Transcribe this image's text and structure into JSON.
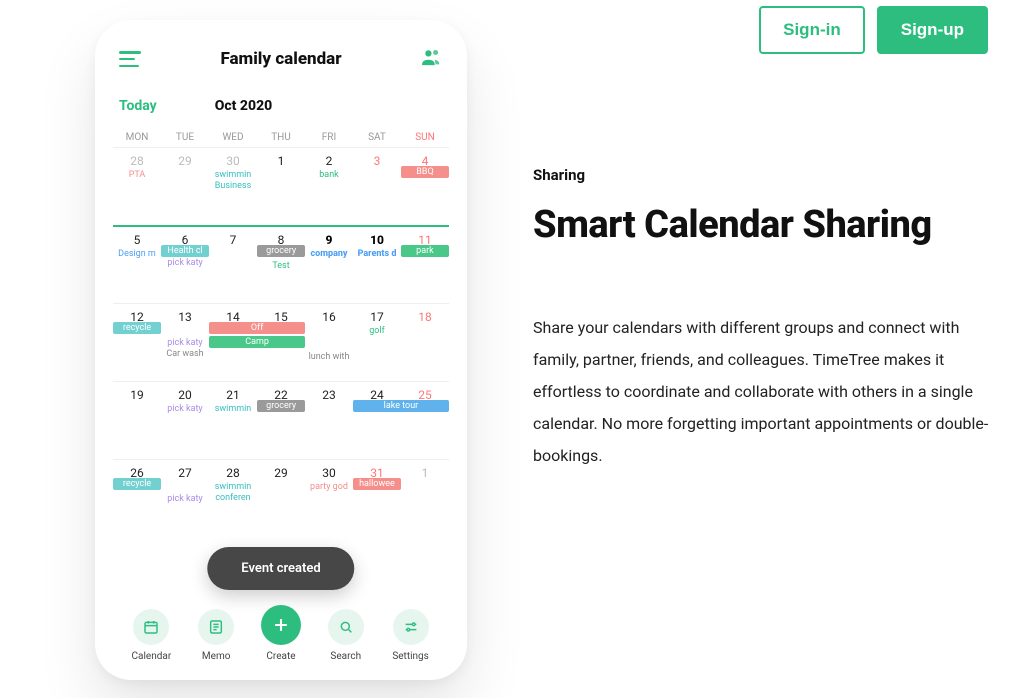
{
  "auth": {
    "signin": "Sign-in",
    "signup": "Sign-up"
  },
  "copy": {
    "eyebrow": "Sharing",
    "headline": "Smart Calendar Sharing",
    "body": "Share your calendars with different groups and connect with family, partner, friends, and colleagues. TimeTree makes it effortless to coordinate and collaborate with others in a single calendar. No more forgetting important appointments or double-bookings."
  },
  "phone": {
    "title": "Family calendar",
    "today": "Today",
    "month": "Oct 2020",
    "weekdays": {
      "mon": "MON",
      "tue": "TUE",
      "wed": "WED",
      "thu": "THU",
      "fri": "FRI",
      "sat": "SAT",
      "sun": "SUN"
    },
    "toast": "Event created",
    "nav": {
      "calendar": "Calendar",
      "memo": "Memo",
      "create": "Create",
      "search": "Search",
      "settings": "Settings"
    },
    "days": {
      "w1": [
        "28",
        "29",
        "30",
        "1",
        "2",
        "3",
        "4"
      ],
      "w2": [
        "5",
        "6",
        "7",
        "8",
        "9",
        "10",
        "11"
      ],
      "w3": [
        "12",
        "13",
        "14",
        "15",
        "16",
        "17",
        "18"
      ],
      "w4": [
        "19",
        "20",
        "21",
        "22",
        "23",
        "24",
        "25"
      ],
      "w5": [
        "26",
        "27",
        "28",
        "29",
        "30",
        "31",
        "1"
      ]
    },
    "ev": {
      "pta": "PTA",
      "swimmin": "swimmin",
      "business": "Business",
      "bank": "bank",
      "bbq": "BBQ",
      "design": "Design m",
      "health": "Health cl",
      "pickkaty": "pick katy",
      "grocery": "grocery",
      "test": "Test",
      "company": "company",
      "parents": "Parents d",
      "park": "park",
      "recycle": "recycle",
      "carwash": "Car wash",
      "off": "Off",
      "camp": "Camp",
      "lunch": "lunch with",
      "golf": "golf",
      "laketour": "lake tour",
      "conferen": "conferen",
      "partygod": "party god",
      "hallowee": "hallowee"
    }
  }
}
